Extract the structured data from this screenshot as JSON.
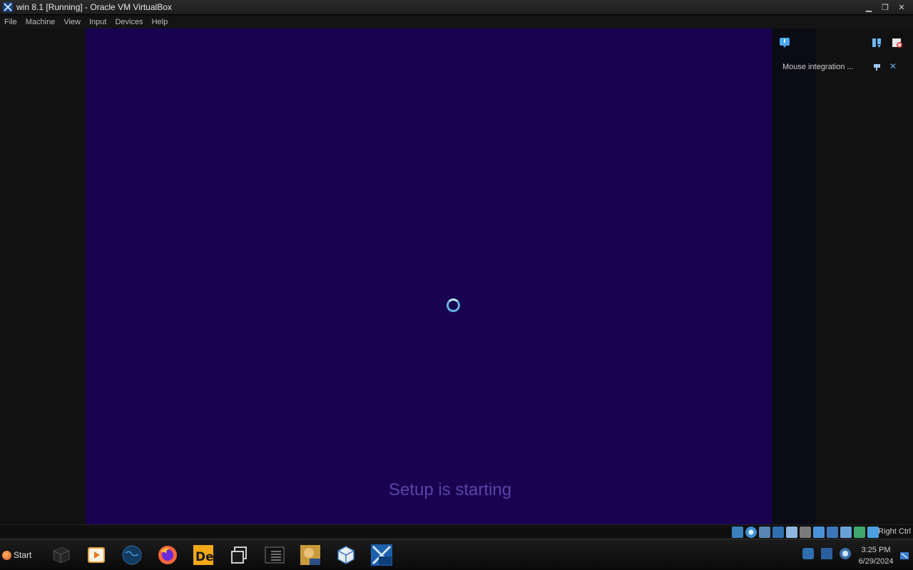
{
  "window": {
    "title": "win 8.1 [Running] - Oracle VM VirtualBox",
    "controls": [
      "minimize",
      "restore",
      "close"
    ]
  },
  "menu": [
    "File",
    "Machine",
    "View",
    "Input",
    "Devices",
    "Help"
  ],
  "guest": {
    "background": "#190350",
    "spinner_color": "#64b4e6",
    "status_text": "Setup is starting"
  },
  "notification_panel": {
    "message": "Mouse integration ..."
  },
  "statusbar": {
    "host_key_label": "Right Ctrl",
    "icons": [
      "hard-disk-icon",
      "optical-drive-icon",
      "audio-icon",
      "network-icon",
      "usb-icon",
      "shared-folders-icon",
      "display-icon",
      "video-capture-icon",
      "cpu-icon",
      "mouse-integration-icon",
      "keyboard-icon"
    ]
  },
  "taskbar": {
    "start_label": "Start",
    "apps": [
      "cube-app",
      "media-player",
      "globe-browser",
      "firefox",
      "de-app",
      "task-view",
      "terminal",
      "puppy-box",
      "virtualbox",
      "win81-vm"
    ],
    "clock": {
      "time": "3:25 PM",
      "date": "6/29/2024"
    }
  },
  "colors": {
    "title_bg": "#1d1d1d",
    "guest_bg": "#190350",
    "setup_text": "#5a43a8",
    "accent_blue": "#5ab0f0"
  }
}
